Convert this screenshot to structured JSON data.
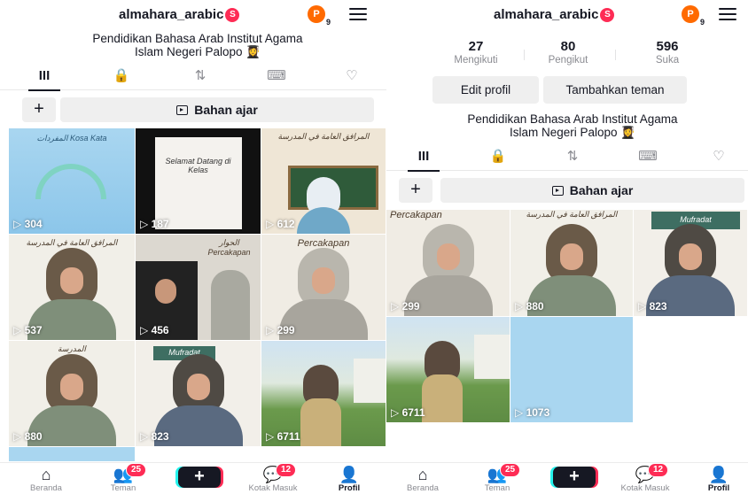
{
  "left": {
    "username": "almahara_arabic",
    "username_badge": "S",
    "avatar_letter": "P",
    "avatar_count": "9",
    "bio_line1": "Pendidikan Bahasa Arab Institut Agama",
    "bio_line2": "Islam Negeri Palopo 👩‍🎓",
    "tabs": [
      "III",
      "🔒",
      "⇅",
      "⌨",
      "♡"
    ],
    "plus_label": "+",
    "bahan_label": "Bahan ajar",
    "tiles": [
      {
        "views": "304",
        "cap": "المفردات Kosa Kata"
      },
      {
        "views": "187",
        "cap": "Selamat Datang di Kelas"
      },
      {
        "views": "612",
        "cap": "المرافق العامة في المدرسة"
      },
      {
        "views": "537",
        "cap": "المرافق العامة في المدرسة"
      },
      {
        "views": "456",
        "cap": "الحوار Percakapan"
      },
      {
        "views": "299",
        "cap": "Percakapan"
      },
      {
        "views": "880",
        "cap": "المدرسة"
      },
      {
        "views": "823",
        "cap": "Mufradat"
      },
      {
        "views": "6711",
        "cap": ""
      }
    ]
  },
  "right": {
    "username": "almahara_arabic",
    "username_badge": "S",
    "avatar_letter": "P",
    "avatar_count": "9",
    "stats": [
      {
        "num": "27",
        "label": "Mengikuti"
      },
      {
        "num": "80",
        "label": "Pengikut"
      },
      {
        "num": "596",
        "label": "Suka"
      }
    ],
    "edit_profile": "Edit profil",
    "add_friend": "Tambahkan teman",
    "bio_line1": "Pendidikan Bahasa Arab Institut Agama",
    "bio_line2": "Islam Negeri Palopo 👩‍🎓",
    "tabs": [
      "III",
      "🔒",
      "⇅",
      "⌨",
      "♡"
    ],
    "plus_label": "+",
    "bahan_label": "Bahan ajar",
    "tiles": [
      {
        "views": "299",
        "cap": "Percakapan"
      },
      {
        "views": "880",
        "cap": "المرافق العامة في المدرسة"
      },
      {
        "views": "823",
        "cap": "Mufradat"
      },
      {
        "views": "6711",
        "cap": ""
      },
      {
        "views": "1073",
        "cap": ""
      }
    ]
  },
  "nav": {
    "beranda": "Beranda",
    "teman": "Teman",
    "teman_badge": "25",
    "create": "+",
    "kotak_masuk": "Kotak Masuk",
    "kotak_badge": "12",
    "profil": "Profil"
  },
  "colors": {
    "accent_red": "#fe2c55",
    "accent_cyan": "#25f4ee",
    "avatar_orange": "#ff6a00"
  }
}
